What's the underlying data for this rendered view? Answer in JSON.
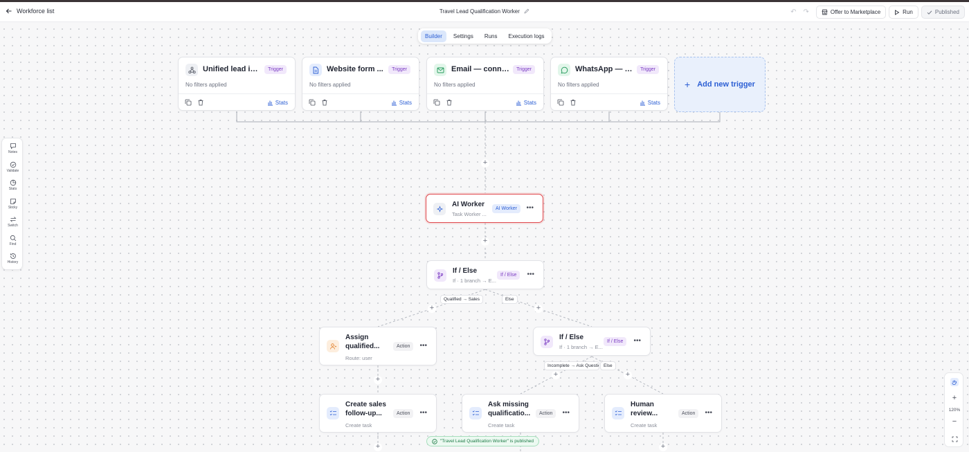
{
  "header": {
    "back_label": "Workforce list",
    "title": "Travel Lead Qualification Worker",
    "offer_label": "Offer to Marketplace",
    "run_label": "Run",
    "published_label": "Published"
  },
  "tabs": [
    "Builder",
    "Settings",
    "Runs",
    "Execution logs"
  ],
  "active_tab": "Builder",
  "triggers": [
    {
      "name": "Unified lead int...",
      "badge": "Trigger",
      "filters": "No filters applied",
      "stats": "Stats",
      "icon": "webhook-icon"
    },
    {
      "name": "Website form ...",
      "badge": "Trigger",
      "filters": "No filters applied",
      "stats": "Stats",
      "icon": "document-icon"
    },
    {
      "name": "Email — conne...",
      "badge": "Trigger",
      "filters": "No filters applied",
      "stats": "Stats",
      "icon": "mail-icon"
    },
    {
      "name": "WhatsApp — c...",
      "badge": "Trigger",
      "filters": "No filters applied",
      "stats": "Stats",
      "icon": "whatsapp-icon"
    }
  ],
  "add_trigger_label": "Add new trigger",
  "ai_worker": {
    "name": "AI Worker",
    "sub": "Task Worker ...",
    "badge": "AI Worker"
  },
  "if_else_1": {
    "name": "If / Else",
    "sub": "If · 1 branch → E...",
    "badge": "If / Else"
  },
  "if_else_2": {
    "name": "If / Else",
    "sub": "If · 1 branch → E...",
    "badge": "If / Else"
  },
  "edge_labels": {
    "qualified": "Qualified → Sales",
    "else1": "Else",
    "incomplete": "Incomplete → Ask Questio",
    "else2": "Else"
  },
  "assign": {
    "name1": "Assign",
    "name2": "qualified...",
    "sub": "Route: user",
    "badge": "Action"
  },
  "create_sales": {
    "name1": "Create sales",
    "name2": "follow-up...",
    "sub": "Create task",
    "badge": "Action"
  },
  "ask_missing": {
    "name1": "Ask missing",
    "name2": "qualificatio...",
    "sub": "Create task",
    "badge": "Action"
  },
  "human_review": {
    "name1": "Human",
    "name2": "review...",
    "sub": "Create task",
    "badge": "Action"
  },
  "sidebar": [
    {
      "label": "Notes",
      "icon": "notes-icon"
    },
    {
      "label": "Validate",
      "icon": "validate-icon"
    },
    {
      "label": "Stats",
      "icon": "stats-icon"
    },
    {
      "label": "Sticky",
      "icon": "sticky-icon"
    },
    {
      "label": "Switch",
      "icon": "switch-icon"
    },
    {
      "label": "Find",
      "icon": "search-icon"
    },
    {
      "label": "History",
      "icon": "history-icon"
    }
  ],
  "zoom_level": "120%",
  "toast": "\"Travel Lead Qualification Worker\" is published",
  "colors": {
    "accent": "#2c5fd4",
    "ai_border": "#e0474c",
    "trigger_badge": "#7a3bc2",
    "success": "#1b7a45"
  }
}
